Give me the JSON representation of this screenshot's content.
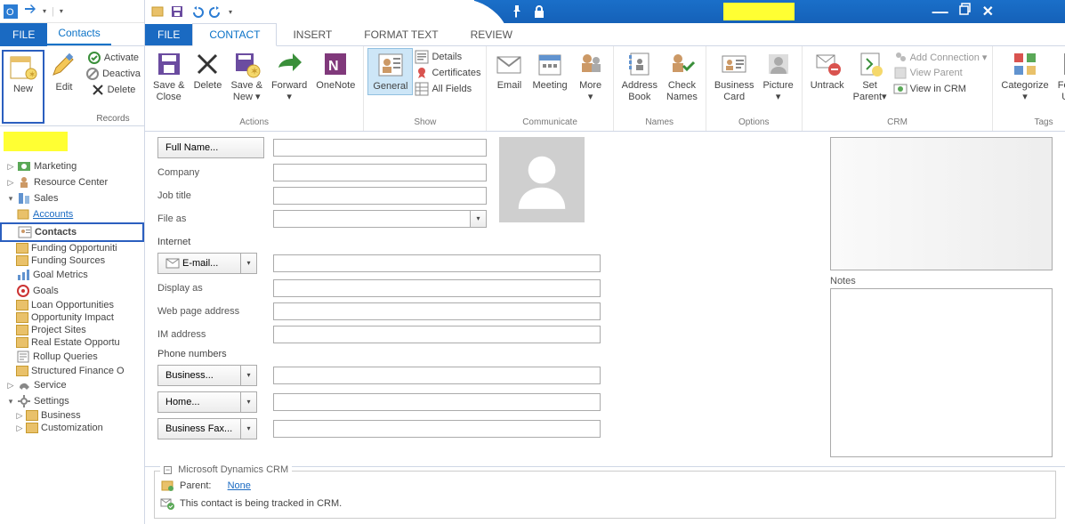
{
  "left": {
    "file": "FILE",
    "tab_contacts": "Contacts",
    "new": "New",
    "edit": "Edit",
    "activate": "Activate",
    "deactivate": "Deactiva",
    "delete": "Delete",
    "group_records": "Records"
  },
  "tree": {
    "marketing": "Marketing",
    "resource_center": "Resource Center",
    "sales": "Sales",
    "accounts": "Accounts",
    "contacts": "Contacts",
    "funding_opp": "Funding Opportuniti",
    "funding_src": "Funding Sources",
    "goal_metrics": "Goal Metrics",
    "goals": "Goals",
    "loan_opp": "Loan Opportunities",
    "opportunity_impact": "Opportunity Impact",
    "project_sites": "Project Sites",
    "real_estate": "Real Estate Opportu",
    "rollup_queries": "Rollup Queries",
    "structured_finance": "Structured Finance O",
    "service": "Service",
    "settings": "Settings",
    "business": "Business",
    "customization": "Customization"
  },
  "tabs2": {
    "file": "FILE",
    "contact": "CONTACT",
    "insert": "INSERT",
    "format_text": "FORMAT TEXT",
    "review": "REVIEW"
  },
  "ribbon": {
    "save_close": "Save &\nClose",
    "delete": "Delete",
    "save_new": "Save &\nNew ▾",
    "forward": "Forward\n▾",
    "onenote": "OneNote",
    "general": "General",
    "details": "Details",
    "certificates": "Certificates",
    "all_fields": "All Fields",
    "email": "Email",
    "meeting": "Meeting",
    "more": "More\n▾",
    "address_book": "Address\nBook",
    "check_names": "Check\nNames",
    "business_card": "Business\nCard",
    "picture": "Picture\n▾",
    "untrack": "Untrack",
    "set_parent": "Set\nParent▾",
    "add_connection": "Add Connection ▾",
    "view_parent": "View Parent",
    "view_in_crm": "View in CRM",
    "categorize": "Categorize\n▾",
    "followup": "Follow\nUp ▾",
    "grp_actions": "Actions",
    "grp_show": "Show",
    "grp_comm": "Communicate",
    "grp_names": "Names",
    "grp_options": "Options",
    "grp_crm": "CRM",
    "grp_tags": "Tags"
  },
  "form": {
    "full_name": "Full Name...",
    "company": "Company",
    "job_title": "Job title",
    "file_as": "File as",
    "internet": "Internet",
    "email": "E-mail...",
    "display_as": "Display as",
    "webpage": "Web page address",
    "im": "IM address",
    "phone_numbers": "Phone numbers",
    "business": "Business...",
    "home": "Home...",
    "business_fax": "Business Fax...",
    "notes": "Notes"
  },
  "crm": {
    "title": "Microsoft Dynamics CRM",
    "parent_label": "Parent:",
    "parent_value": "None",
    "tracked_msg": "This contact is being tracked in CRM."
  }
}
